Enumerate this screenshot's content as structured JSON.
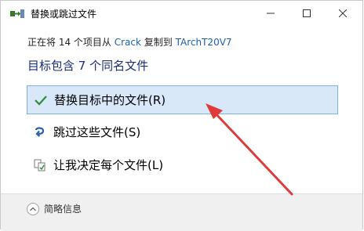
{
  "window": {
    "title": "替换或跳过文件"
  },
  "status": {
    "prefix": "正在将 14 个项目从",
    "source": "Crack",
    "middle": "复制到",
    "destination": "TArchT20V7"
  },
  "heading": "目标包含 7 个同名文件",
  "options": [
    {
      "label": "替换目标中的文件(R)",
      "icon": "check-icon",
      "selected": true
    },
    {
      "label": "跳过这些文件(S)",
      "icon": "skip-icon",
      "selected": false
    },
    {
      "label": "让我决定每个文件(L)",
      "icon": "decide-icon",
      "selected": false
    }
  ],
  "footer": {
    "details_label": "简略信息"
  },
  "colors": {
    "accent_border": "#7fb1e2",
    "accent_bg": "#d8e8f8",
    "heading": "#1a2c7d",
    "link": "#1b62ad",
    "annotation_arrow": "#e03a3a"
  }
}
